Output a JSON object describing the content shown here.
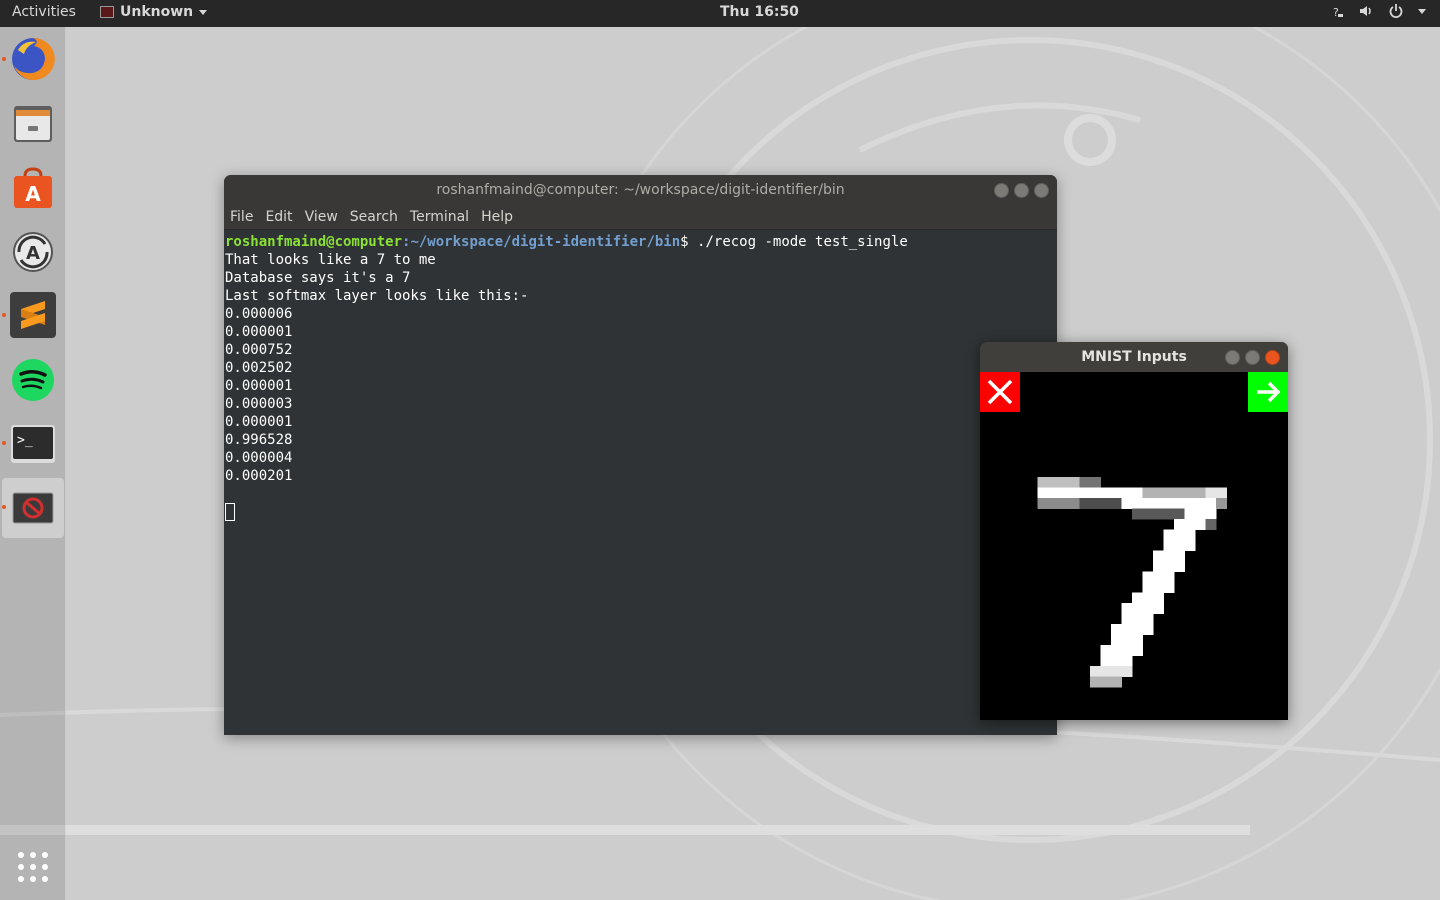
{
  "topbar": {
    "activities": "Activities",
    "app_name": "Unknown",
    "clock": "Thu 16:50",
    "tray_icons": [
      "question-icon",
      "volume-icon",
      "power-icon"
    ]
  },
  "dock": {
    "items": [
      {
        "name": "firefox",
        "running": true
      },
      {
        "name": "files",
        "running": false
      },
      {
        "name": "ubuntu-software",
        "running": false
      },
      {
        "name": "software-updater",
        "running": false
      },
      {
        "name": "sublime-text",
        "running": true
      },
      {
        "name": "spotify",
        "running": false
      },
      {
        "name": "terminal",
        "running": true
      },
      {
        "name": "unknown-app",
        "running": true
      }
    ],
    "show_apps": "show-applications-icon"
  },
  "terminal": {
    "title": "roshanfmaind@computer: ~/workspace/digit-identifier/bin",
    "menu": [
      "File",
      "Edit",
      "View",
      "Search",
      "Terminal",
      "Help"
    ],
    "prompt_user": "roshanfmaind@computer",
    "prompt_path": ":~/workspace/digit-identifier/bin",
    "prompt_cmd": "$ ./recog -mode test_single",
    "output_lines": [
      "That looks like a 7 to me",
      "Database says it's a 7",
      "",
      "Last softmax layer looks like this:-",
      "0.000006",
      "0.000001",
      "0.000752",
      "0.002502",
      "0.000001",
      "0.000003",
      "0.000001",
      "0.996528",
      "0.000004",
      "0.000201"
    ]
  },
  "mnist": {
    "title": "MNIST Inputs",
    "close_icon": "close-x-icon",
    "next_icon": "arrow-right-icon",
    "digit_label_shown": "7"
  },
  "colors": {
    "ubuntu_orange": "#e95420",
    "prompt_green": "#8ae234",
    "prompt_blue": "#729fcf",
    "close_red": "#ff0000",
    "next_green": "#00ff00"
  }
}
